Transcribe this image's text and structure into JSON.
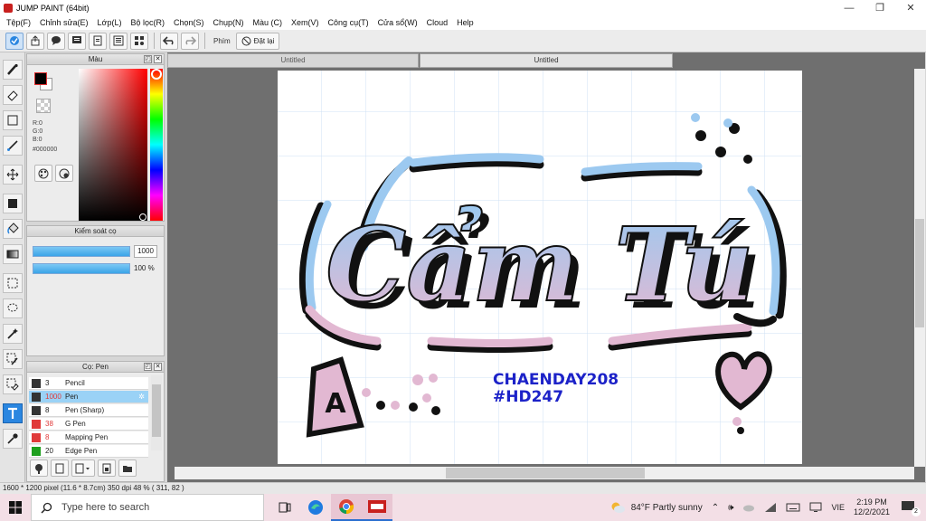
{
  "window": {
    "title": "JUMP PAINT (64bit)",
    "controls": [
      "—",
      "❐",
      "✕"
    ]
  },
  "menu": [
    "Tệp(F)",
    "Chỉnh sửa(E)",
    "Lớp(L)",
    "Bộ lọc(R)",
    "Chọn(S)",
    "Chụp(N)",
    "Màu (C)",
    "Xem(V)",
    "Công cụ(T)",
    "Cửa sổ(W)",
    "Cloud",
    "Help"
  ],
  "toolbar": {
    "key_label": "Phím",
    "reset_label": "Đặt lại"
  },
  "color_panel": {
    "title": "Màu",
    "r": "R:0",
    "g": "G:0",
    "b": "B:0",
    "hex": "#000000",
    "primary_color": "#000000",
    "secondary_color": "#ffffff"
  },
  "brush_control": {
    "title": "Kiểm soát cọ",
    "size_value": "1000",
    "opacity_value": "100 %",
    "size_fill": 1.0,
    "opacity_fill": 1.0
  },
  "brush_list": {
    "title": "Cọ: Pen",
    "items": [
      {
        "size": "3",
        "name": "Pencil",
        "color": "#333333",
        "selected": false
      },
      {
        "size": "1000",
        "name": "Pen",
        "color": "#333333",
        "selected": true
      },
      {
        "size": "8",
        "name": "Pen (Sharp)",
        "color": "#333333",
        "selected": false
      },
      {
        "size": "38",
        "name": "G Pen",
        "color": "#e03a3a",
        "selected": false
      },
      {
        "size": "8",
        "name": "Mapping Pen",
        "color": "#e03a3a",
        "selected": false
      },
      {
        "size": "20",
        "name": "Edge Pen",
        "color": "#1ea01e",
        "selected": false
      }
    ]
  },
  "tabs": [
    "Untitled",
    "Untitled"
  ],
  "artwork": {
    "main_text": "Cẩm Tú",
    "handle": "CHAENDAY208",
    "tag": "#HD247",
    "letter": "A"
  },
  "status": {
    "text": "1600 * 1200 pixel   (11.6 * 8.7cm)   350 dpi   48 %   ( 311, 82 )"
  },
  "taskbar": {
    "search_placeholder": "Type here to search",
    "weather": "84°F  Partly sunny",
    "lang": "VIE",
    "time": "2:19 PM",
    "date": "12/2/2021",
    "notifications": "2"
  }
}
